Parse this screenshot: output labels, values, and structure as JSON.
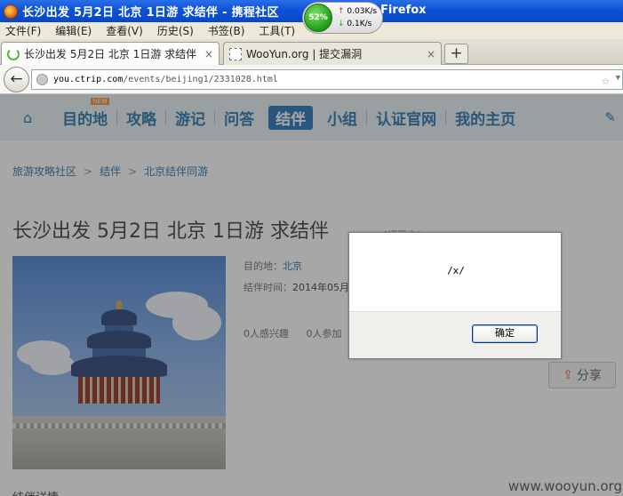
{
  "window": {
    "title": "长沙出发 5月2日 北京 1日游 求结伴 - 携程社区",
    "title_suffix": "Firefox"
  },
  "netmeter": {
    "cpu": "52%",
    "upload": "0.03K/s",
    "download": "0.1K/s"
  },
  "menubar": {
    "items": [
      "文件(F)",
      "编辑(E)",
      "查看(V)",
      "历史(S)",
      "书签(B)",
      "工具(T)"
    ]
  },
  "tabs": [
    {
      "title": "长沙出发 5月2日 北京 1日游 求结伴 ...",
      "close": "×"
    },
    {
      "title": "WooYun.org | 提交漏洞",
      "close": "×"
    }
  ],
  "newtab": "+",
  "navbar": {
    "back": "←",
    "url_host": "you.ctrip.com",
    "url_path": "/events/beijing1/2331028.html",
    "star": "☆",
    "dropdown": "▼"
  },
  "sitenav": {
    "home": "⌂",
    "items": [
      "目的地",
      "攻略",
      "游记",
      "问答",
      "结伴",
      "小组",
      "认证官网",
      "我的主页"
    ],
    "new_badge": "NEW",
    "edit": "✎"
  },
  "breadcrumb": [
    "旅游攻略社区",
    "结伴",
    "北京结伴同游"
  ],
  "breadcrumb_sep": ">",
  "event": {
    "title": "长沙出发 5月2日 北京 1日游 求结伴",
    "status": "[招募中]",
    "dest_label": "目的地：",
    "dest_value": "北京",
    "time_label": "结伴时间：",
    "time_value": "2014年05月",
    "interested": "0人感兴趣",
    "joined": "0人参加",
    "share": "分享",
    "details_heading": "结伴详情"
  },
  "dialog": {
    "message": "/x/",
    "ok": "确定"
  },
  "watermark": "www.wooyun.org"
}
